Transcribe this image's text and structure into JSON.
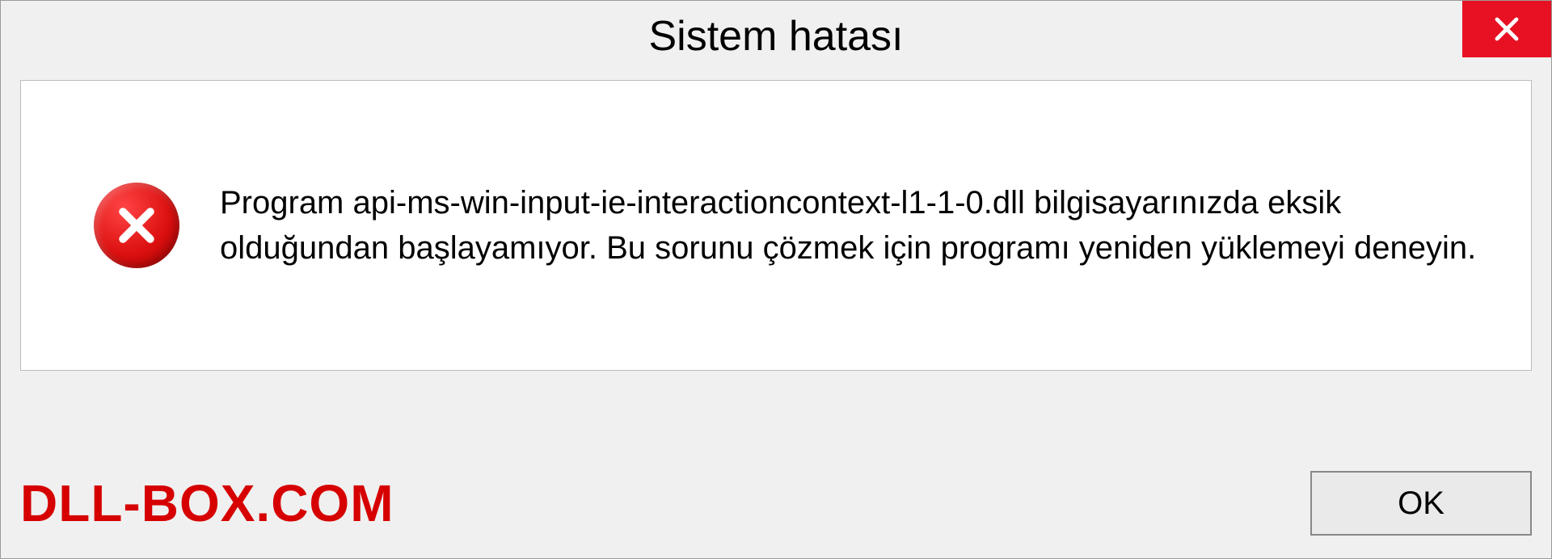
{
  "dialog": {
    "title": "Sistem hatası",
    "message": "Program api-ms-win-input-ie-interactioncontext-l1-1-0.dll bilgisayarınızda eksik olduğundan başlayamıyor. Bu sorunu çözmek için programı yeniden yüklemeyi deneyin.",
    "ok_label": "OK"
  },
  "watermark": "DLL-BOX.COM"
}
